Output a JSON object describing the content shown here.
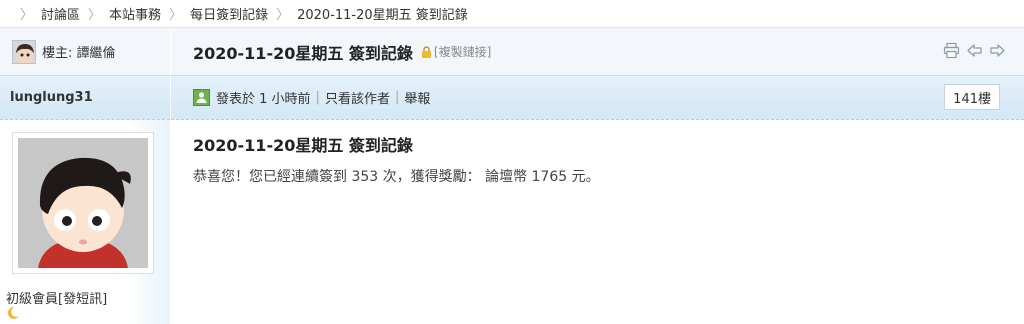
{
  "breadcrumb": [
    {
      "label": "討論區"
    },
    {
      "label": "本站事務"
    },
    {
      "label": "每日簽到記錄"
    },
    {
      "label": "2020-11-20星期五 簽到記錄"
    }
  ],
  "thread": {
    "host_label": "樓主: 譚繼倫",
    "title": "2020-11-20星期五 簽到記錄",
    "copy_link": "[複製鏈接]"
  },
  "tools": [
    "print-icon",
    "prev-thread-icon",
    "next-thread-icon"
  ],
  "post": {
    "author": "lunglung31",
    "posted_at": "發表於 1 小時前",
    "only_author": "只看該作者",
    "report": "舉報",
    "floor": "141樓",
    "title": "2020-11-20星期五 簽到記錄",
    "text": "恭喜您！您已經連續簽到 353 次，獲得獎勵： 論壇幣 1765 元。"
  },
  "profile": {
    "rank": "初級會員",
    "pm_link": "[發短訊]"
  },
  "colors": {
    "bar_blue": "#d3e7f5",
    "head_bg": "#f3f7fb",
    "post_icon_green": "#6bb34a"
  }
}
